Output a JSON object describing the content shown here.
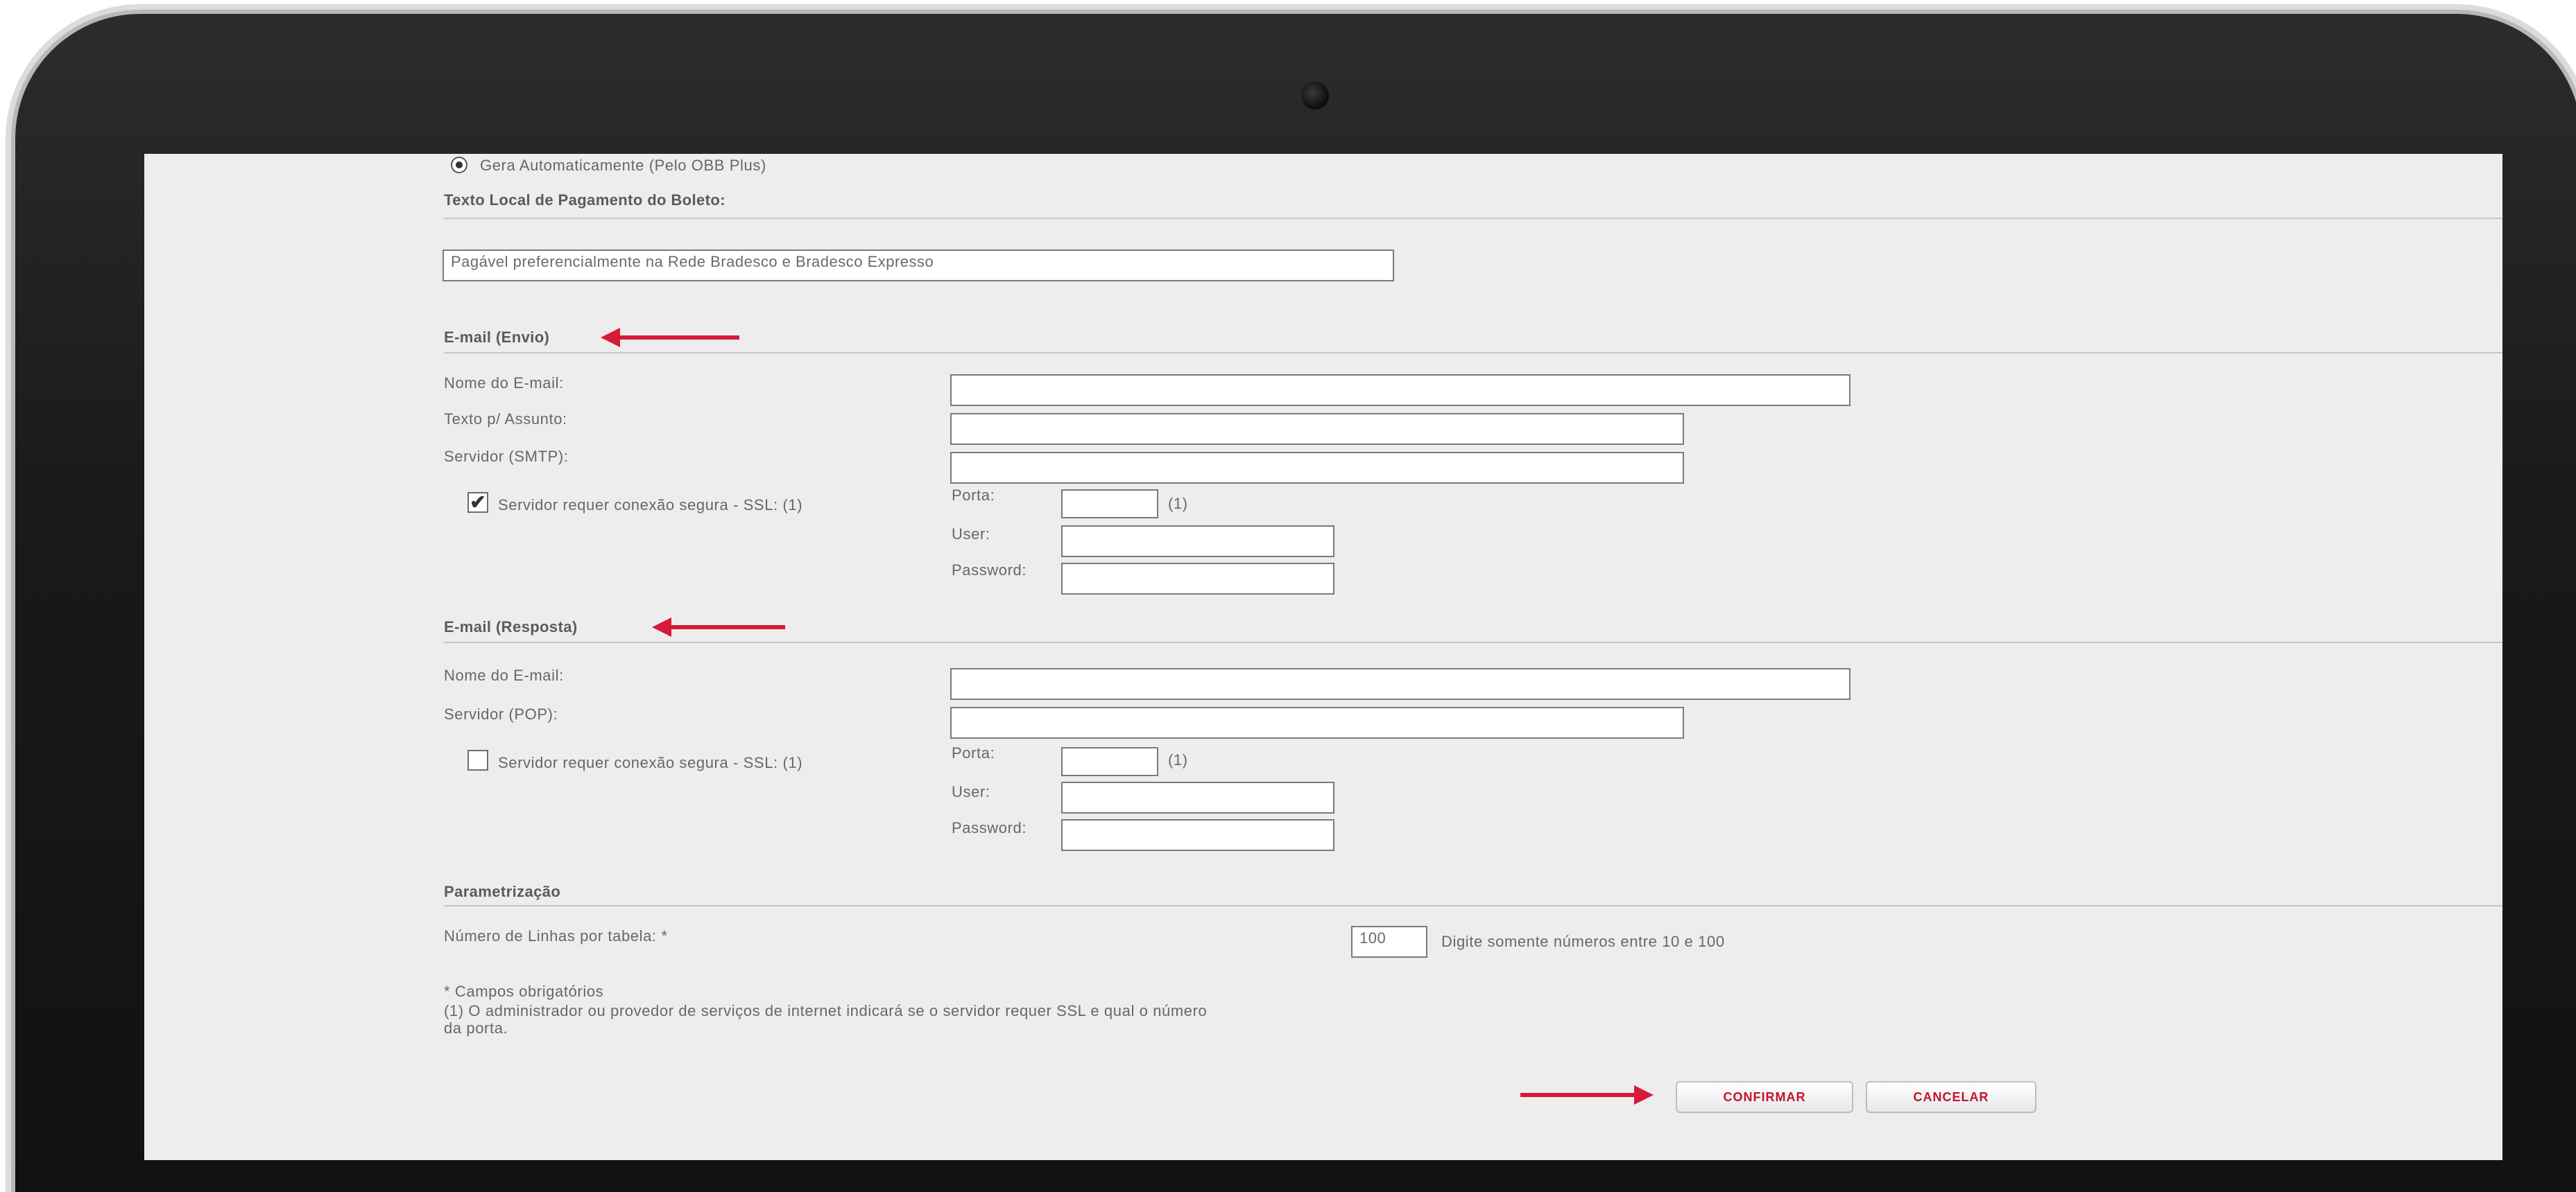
{
  "radio_auto": {
    "label": "Gera Automaticamente (Pelo OBB Plus)"
  },
  "boleto": {
    "heading": "Texto Local de Pagamento do Boleto:",
    "value": "Pagável preferencialmente na Rede Bradesco e Bradesco Expresso"
  },
  "envio": {
    "heading": "E-mail (Envio)",
    "nome_label": "Nome do E-mail:",
    "assunto_label": "Texto p/ Assunto:",
    "servidor_label": "Servidor (SMTP):",
    "ssl_label": "Servidor requer conexão segura - SSL: (1)",
    "ssl_checked": true,
    "check_mark": "✔",
    "porta_label": "Porta:",
    "porta_note": "(1)",
    "user_label": "User:",
    "password_label": "Password:"
  },
  "resposta": {
    "heading": "E-mail (Resposta)",
    "nome_label": "Nome do E-mail:",
    "servidor_label": "Servidor (POP):",
    "ssl_label": "Servidor requer conexão segura - SSL: (1)",
    "ssl_checked": false,
    "porta_label": "Porta:",
    "porta_note": "(1)",
    "user_label": "User:",
    "password_label": "Password:"
  },
  "parametrizacao": {
    "heading": "Parametrização",
    "linhas_label": "Número de Linhas por tabela: *",
    "linhas_value": "100",
    "linhas_hint": "Digite somente números entre 10 e 100"
  },
  "notes": {
    "required": "* Campos obrigatórios",
    "ssl_note": "(1) O administrador ou provedor de serviços de internet indicará se o servidor requer SSL e qual o número\nda porta."
  },
  "buttons": {
    "confirm": "CONFIRMAR",
    "cancel": "CANCELAR"
  },
  "colors": {
    "accent_red": "#d71a3a",
    "button_text": "#c4122f",
    "panel_bg": "#ededed"
  }
}
